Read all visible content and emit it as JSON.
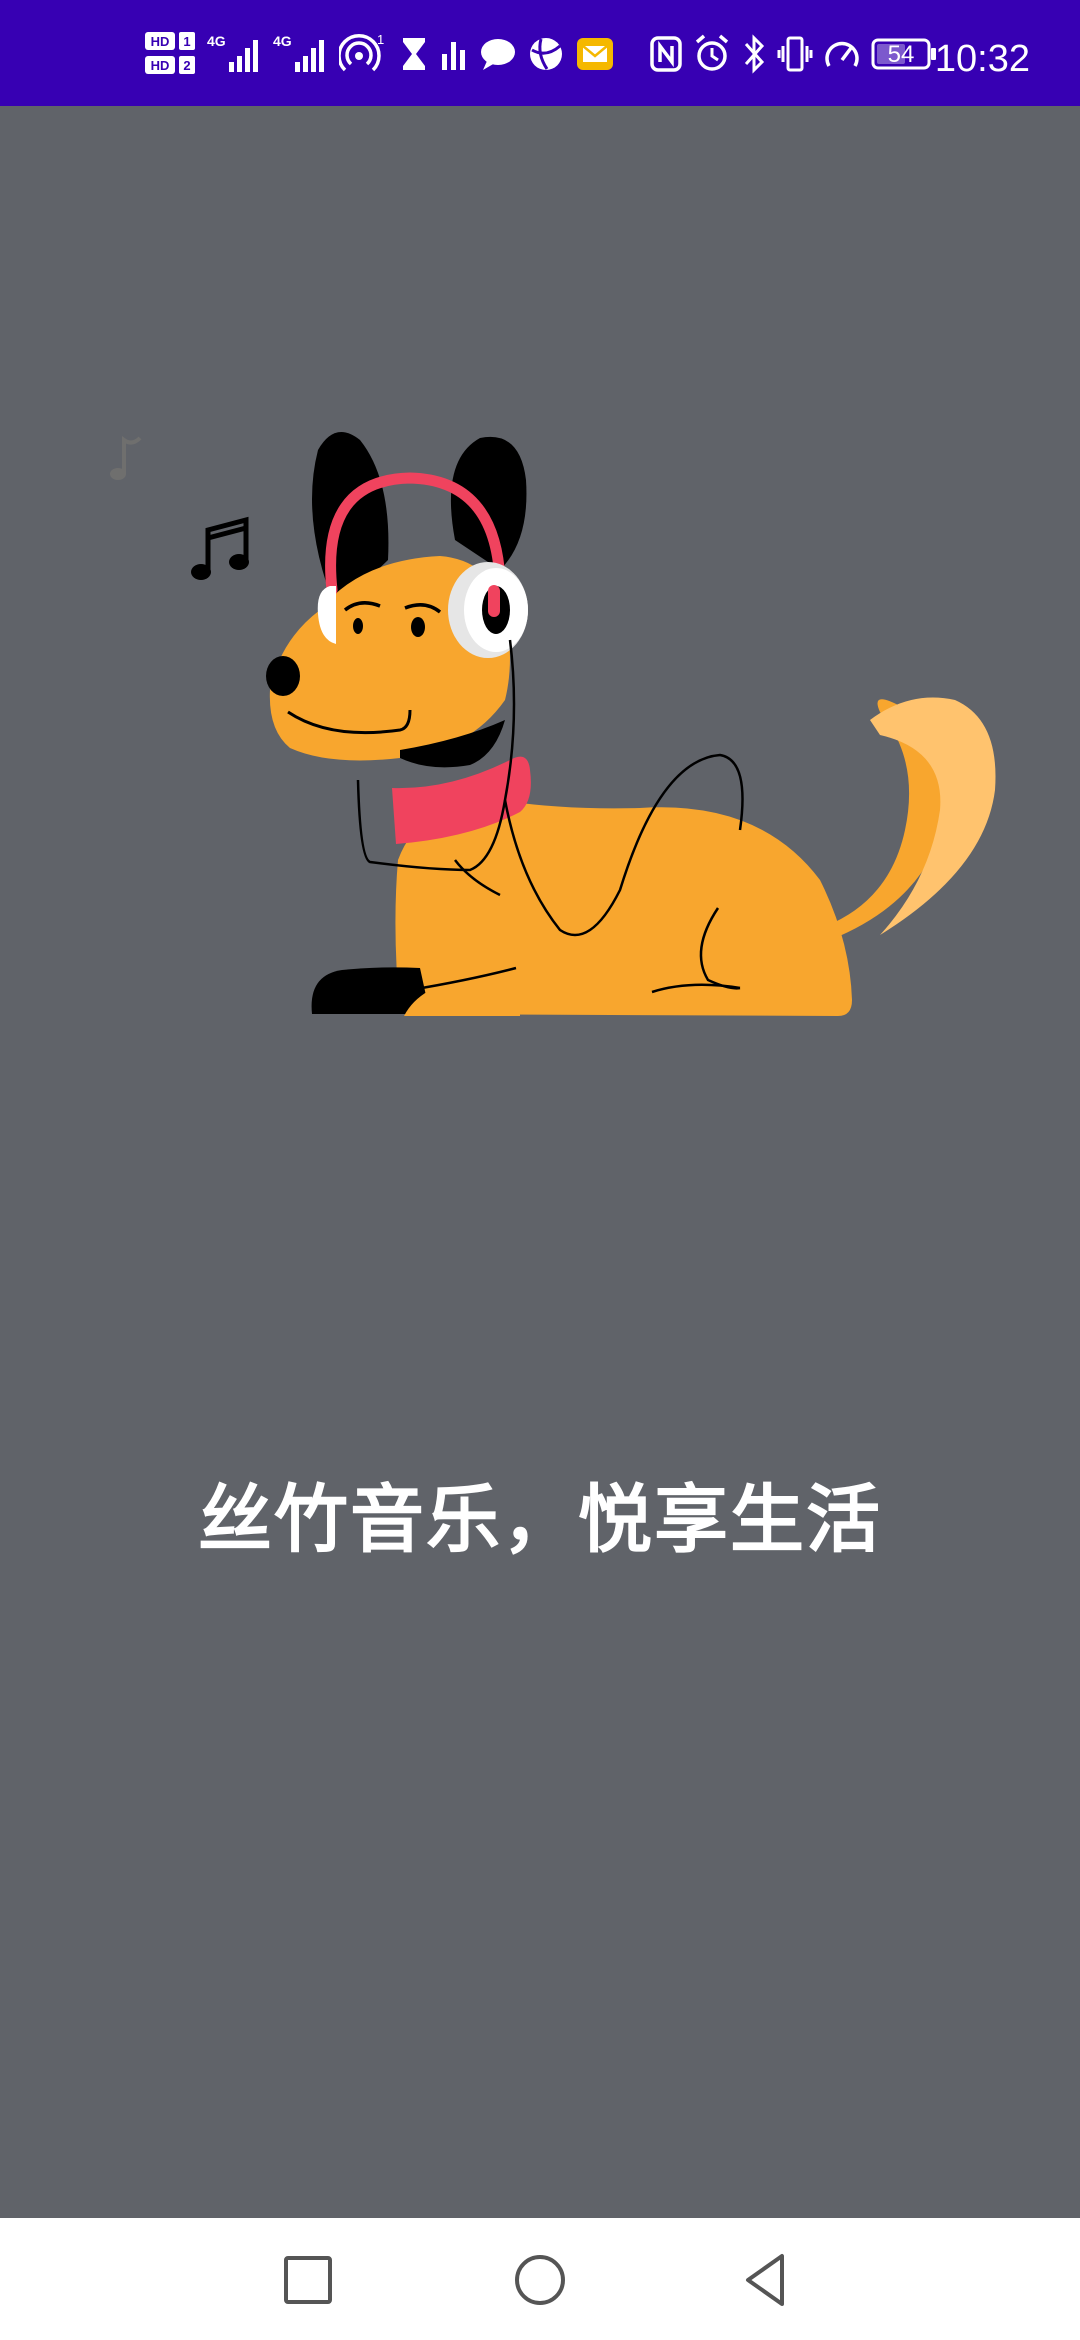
{
  "status_bar": {
    "time": "10:32",
    "battery_level": "54",
    "sim1_label": "HD 1",
    "sim2_label": "HD 2",
    "network_type_1": "4G",
    "network_type_2": "4G",
    "hotspot_count": "1",
    "icons": [
      "hd-sim-icon",
      "signal-4g-icon",
      "signal-4g-icon",
      "hotspot-icon",
      "hourglass-icon",
      "bar-chart-icon",
      "chat-bubble-icon",
      "globe-app-icon",
      "mail-icon",
      "nfc-icon",
      "alarm-icon",
      "bluetooth-icon",
      "vibrate-icon",
      "speed-icon",
      "battery-icon"
    ],
    "background_color": "#3700B3"
  },
  "splash": {
    "slogan": "丝竹音乐，悦享生活",
    "background_color": "#606369",
    "illustration": "dog-with-headphones-illustration"
  },
  "nav_bar": {
    "buttons": [
      "recent-apps-button",
      "home-button",
      "back-button"
    ]
  }
}
